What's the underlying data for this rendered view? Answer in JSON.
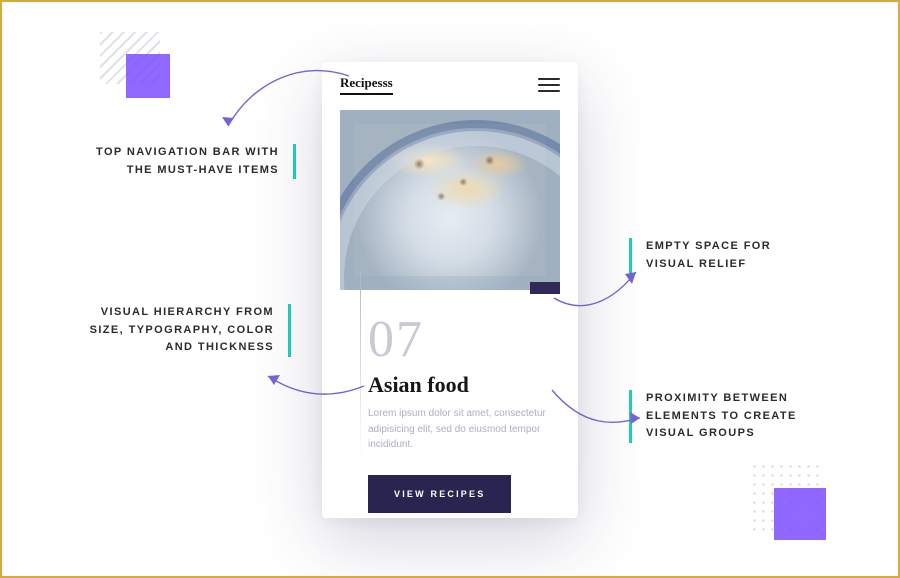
{
  "annotations": {
    "topnav": "TOP NAVIGATION BAR WITH THE MUST-HAVE ITEMS",
    "hierarchy": "VISUAL HIERARCHY FROM SIZE, TYPOGRAPHY, COLOR AND THICKNESS",
    "emptyspace": "EMPTY SPACE FOR VISUAL RELIEF",
    "proximity": "PROXIMITY BETWEEN ELEMENTS TO CREATE VISUAL GROUPS"
  },
  "app": {
    "brand": "Recipesss",
    "card": {
      "number": "07",
      "title": "Asian food",
      "description": "Lorem ipsum dolor sit amet, consectetur adipisicing elit, sed do eiusmod tempor incididunt.",
      "cta": "VIEW RECIPES"
    }
  },
  "colors": {
    "accent_purple": "#7c4dff",
    "frame_gold": "#d9a93c",
    "callout_teal": "#1fd1b5",
    "button_navy": "#2a2550"
  }
}
